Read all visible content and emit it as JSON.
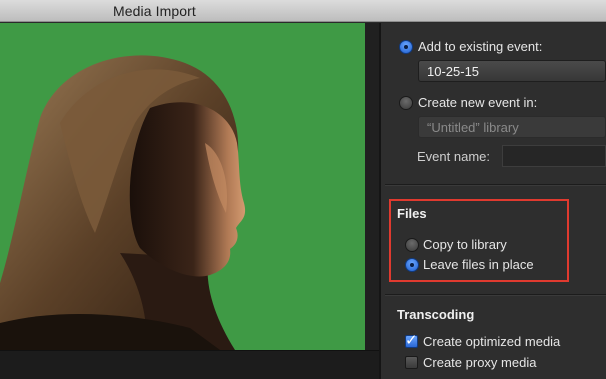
{
  "window": {
    "title": "Media Import"
  },
  "viewer": {
    "subject": "woman-portrait-on-green-screen",
    "background_color": "#3f9a45"
  },
  "options": {
    "event": {
      "add_existing_label": "Add to existing event:",
      "add_existing_selected": true,
      "existing_event_value": "10-25-15",
      "create_new_label": "Create new event in:",
      "create_new_selected": false,
      "new_event_library_value": "“Untitled” library",
      "event_name_label": "Event name:",
      "event_name_value": ""
    },
    "files": {
      "title": "Files",
      "copy_label": "Copy to library",
      "copy_selected": false,
      "leave_label": "Leave files in place",
      "leave_selected": true
    },
    "transcoding": {
      "title": "Transcoding",
      "optimized_label": "Create optimized media",
      "optimized_checked": true,
      "proxy_label": "Create proxy media",
      "proxy_checked": false
    }
  },
  "colors": {
    "accent_blue": "#2a67d4",
    "highlight_red": "#e03a2f",
    "panel_bg": "#2e2e2e"
  }
}
